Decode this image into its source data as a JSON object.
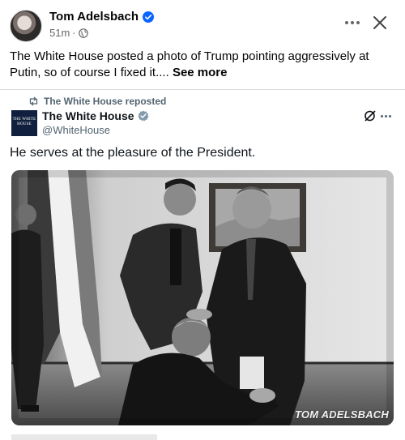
{
  "header": {
    "author": "Tom Adelsbach",
    "time": "51m",
    "separator": "·"
  },
  "caption": {
    "text": "The White House posted a photo of Trump pointing aggressively at Putin, so of course I fixed it.... ",
    "see_more": "See more"
  },
  "embedded_post": {
    "repost_label": "The White House reposted",
    "name": "The White House",
    "handle": "@WhiteHouse",
    "logo_text": "THE WHITE HOUSE",
    "text": "He serves at the pleasure of the President.",
    "watermark": "TOM ADELSBACH"
  },
  "colors": {
    "verified_fb": "#0866ff",
    "verified_x": "#829aab",
    "secondary_text": "#65676b"
  },
  "icons": {
    "verified": "verified-badge-icon",
    "globe": "globe-icon",
    "more": "more-options-icon",
    "close": "close-icon",
    "repost": "repost-icon",
    "grok": "grok-icon"
  }
}
